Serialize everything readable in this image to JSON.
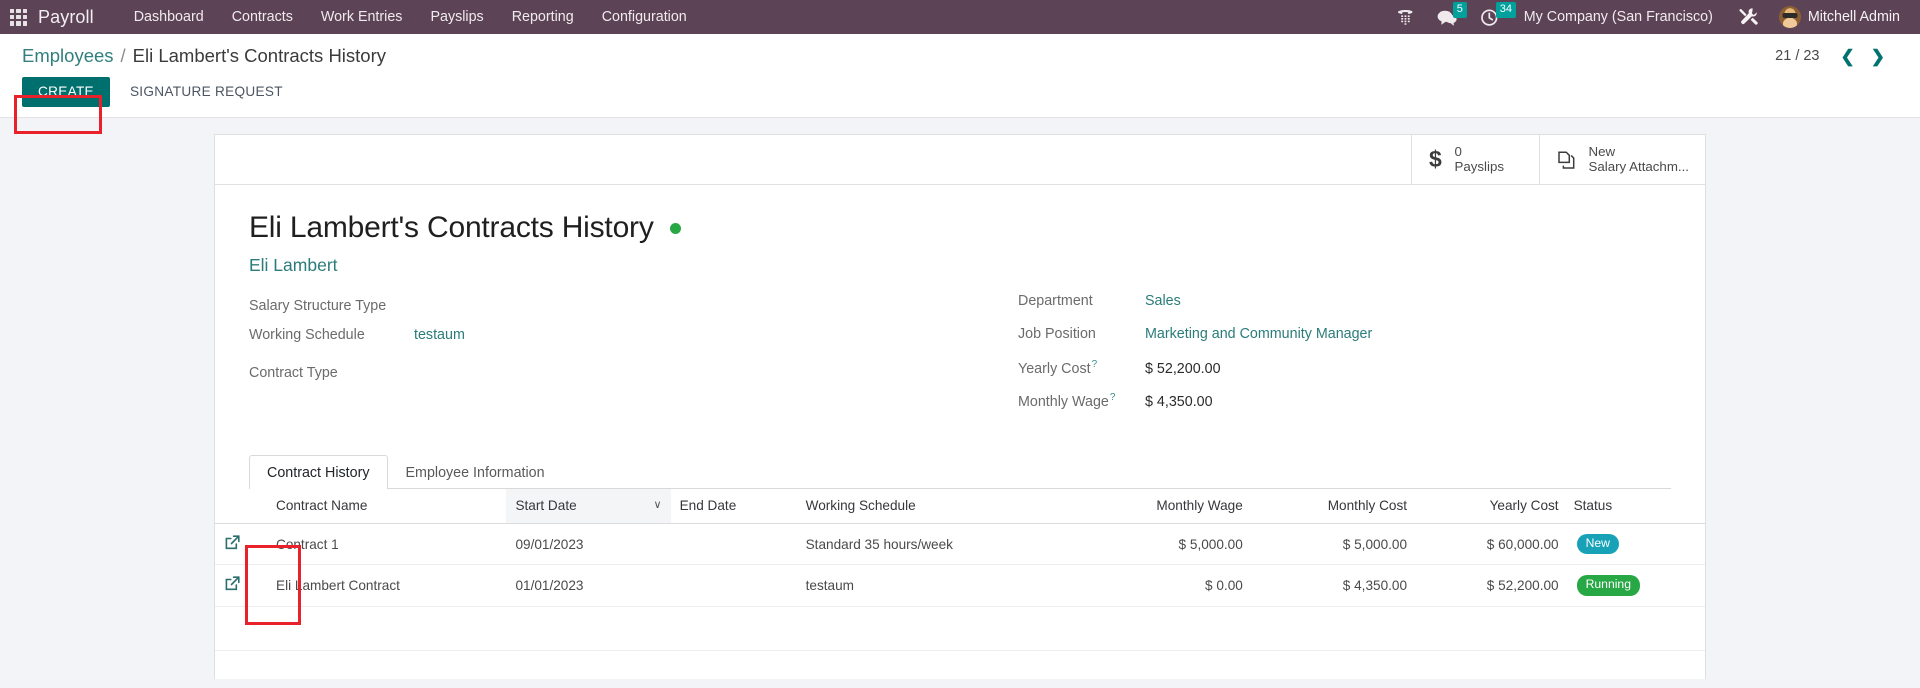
{
  "navbar": {
    "brand": "Payroll",
    "apps_icon": "apps-grid-icon",
    "menu": [
      {
        "label": "Dashboard"
      },
      {
        "label": "Contracts"
      },
      {
        "label": "Work Entries"
      },
      {
        "label": "Payslips"
      },
      {
        "label": "Reporting"
      },
      {
        "label": "Configuration"
      }
    ],
    "icons": [
      {
        "name": "phone-icon",
        "badge": ""
      },
      {
        "name": "messages-icon",
        "badge": "5"
      },
      {
        "name": "activities-clock-icon",
        "badge": "34"
      }
    ],
    "company": "My Company (San Francisco)",
    "tools_icon": "tools-wrench-icon",
    "user": "Mitchell Admin",
    "bg_color": "#5c4456",
    "badge_color": "#00a09d"
  },
  "breadcrumb": {
    "root": "Employees",
    "separator": "/",
    "current": "Eli Lambert's Contracts History"
  },
  "pager": {
    "value": "21 / 23",
    "prev_icon": "chevron-left-icon",
    "next_icon": "chevron-right-icon"
  },
  "buttons": {
    "create": "CREATE",
    "signature_request": "SIGNATURE REQUEST",
    "create_accent": "#00706e"
  },
  "stat_buttons": [
    {
      "icon": "dollar-icon",
      "value": "0",
      "label": "Payslips"
    },
    {
      "icon": "documents-copy-icon",
      "value": "New",
      "label": "Salary Attachm..."
    }
  ],
  "record": {
    "title": "Eli Lambert's Contracts History",
    "status_dot_color": "#28a745",
    "employee": "Eli Lambert",
    "left_fields": [
      {
        "label": "Salary Structure Type",
        "value": "",
        "link": false
      },
      {
        "label": "Working Schedule",
        "value": "testaum",
        "link": true
      },
      {
        "label": "Contract Type",
        "value": "",
        "link": false
      }
    ],
    "right_fields": [
      {
        "label": "Department",
        "value": "Sales",
        "link": true,
        "help": false
      },
      {
        "label": "Job Position",
        "value": "Marketing and Community Manager",
        "link": true,
        "help": false
      },
      {
        "label": "Yearly Cost",
        "value": "$ 52,200.00",
        "link": false,
        "help": true
      },
      {
        "label": "Monthly Wage",
        "value": "$ 4,350.00",
        "link": false,
        "help": true
      }
    ]
  },
  "notebook": {
    "tabs": [
      {
        "label": "Contract History",
        "active": true
      },
      {
        "label": "Employee Information",
        "active": false
      }
    ]
  },
  "table": {
    "columns": [
      {
        "label": "Contract Name",
        "align": "left",
        "sorted": false
      },
      {
        "label": "Start Date",
        "align": "left",
        "sorted": true,
        "caret": "∨"
      },
      {
        "label": "End Date",
        "align": "left",
        "sorted": false
      },
      {
        "label": "Working Schedule",
        "align": "left",
        "sorted": false
      },
      {
        "label": "Monthly Wage",
        "align": "right",
        "sorted": false
      },
      {
        "label": "Monthly Cost",
        "align": "right",
        "sorted": false
      },
      {
        "label": "Yearly Cost",
        "align": "right",
        "sorted": false
      },
      {
        "label": "Status",
        "align": "left",
        "sorted": false
      }
    ],
    "rows": [
      {
        "open_icon": "external-link-icon",
        "contract_name": "Contract 1",
        "start_date": "09/01/2023",
        "end_date": "",
        "working_schedule": "Standard 35 hours/week",
        "monthly_wage": "$ 5,000.00",
        "monthly_cost": "$ 5,000.00",
        "yearly_cost": "$ 60,000.00",
        "status": "New",
        "status_kind": "new",
        "highlighted": false
      },
      {
        "open_icon": "external-link-icon",
        "contract_name": "Eli Lambert Contract",
        "start_date": "01/01/2023",
        "end_date": "",
        "working_schedule": "testaum",
        "monthly_wage": "$ 0.00",
        "monthly_cost": "$ 4,350.00",
        "yearly_cost": "$ 52,200.00",
        "status": "Running",
        "status_kind": "running",
        "highlighted": true
      }
    ]
  },
  "annotations": {
    "create_box": "red-highlight-create-button",
    "open_col_box": "red-highlight-open-record-column"
  }
}
